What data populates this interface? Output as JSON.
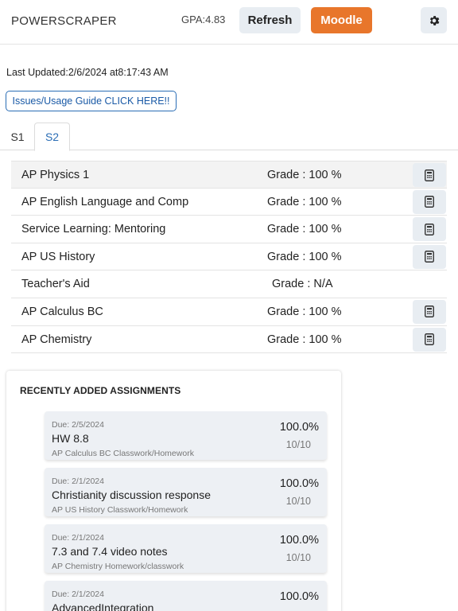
{
  "header": {
    "brand": "POWERSCRAPER",
    "gpa": "GPA:4.83",
    "refresh_label": "Refresh",
    "moodle_label": "Moodle",
    "settings_icon": "gear-icon"
  },
  "last_updated": "Last Updated:2/6/2024 at8:17:43 AM",
  "guide_label": "Issues/Usage Guide CLICK HERE!!",
  "tabs": [
    {
      "label": "S1",
      "active": false
    },
    {
      "label": "S2",
      "active": true
    }
  ],
  "classes": [
    {
      "name": "AP Physics 1",
      "grade": "Grade : 100 %",
      "has_calculator": true
    },
    {
      "name": "AP English Language and Comp",
      "grade": "Grade : 100 %",
      "has_calculator": true
    },
    {
      "name": "Service Learning: Mentoring",
      "grade": "Grade : 100 %",
      "has_calculator": true
    },
    {
      "name": "AP US History",
      "grade": "Grade : 100 %",
      "has_calculator": true
    },
    {
      "name": "Teacher's Aid",
      "grade": "Grade : N/A",
      "has_calculator": false
    },
    {
      "name": "AP Calculus BC",
      "grade": "Grade : 100 %",
      "has_calculator": true
    },
    {
      "name": "AP Chemistry",
      "grade": "Grade : 100 %",
      "has_calculator": true
    }
  ],
  "recent": {
    "title": "RECENTLY ADDED ASSIGNMENTS",
    "assignments": [
      {
        "due": "Due: 2/5/2024",
        "name": "HW 8.8",
        "class": "AP Calculus BC Classwork/Homework",
        "percent": "100.0%",
        "points": "10/10"
      },
      {
        "due": "Due: 2/1/2024",
        "name": "Christianity discussion response",
        "class": "AP US History Classwork/Homework",
        "percent": "100.0%",
        "points": "10/10"
      },
      {
        "due": "Due: 2/1/2024",
        "name": "7.3 and 7.4 video notes",
        "class": "AP Chemistry Homework/classwork",
        "percent": "100.0%",
        "points": "10/10"
      },
      {
        "due": "Due: 2/1/2024",
        "name": "AdvancedIntegration",
        "class": "",
        "percent": "100.0%",
        "points": ""
      }
    ]
  },
  "colors": {
    "accent": "#e8762b",
    "link": "#2a6db5",
    "button_bg": "#e8edf2"
  }
}
